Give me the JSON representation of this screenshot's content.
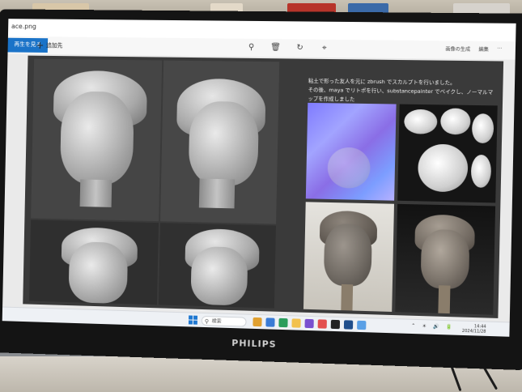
{
  "window": {
    "file_name": "ace.png"
  },
  "toolbar": {
    "slideshow_label": "再生を見る",
    "add_label": "追加先",
    "zoom_icon": "zoom-in-icon",
    "delete_icon": "trash-icon",
    "rotate_icon": "rotate-icon",
    "crop_icon": "crop-icon",
    "right_label_1": "画像の生成",
    "right_label_2": "編集"
  },
  "image": {
    "caption_line1": "粘土で形った友人を元に zbrush でスカルプトを行いました。",
    "caption_line2": "その後、maya でリトポを行い、substancepainter でベイクし、ノーマルマップを作成しました"
  },
  "taskbar": {
    "search_label": "検索",
    "tray_time": "14:44",
    "tray_date": "2024/11/28"
  },
  "monitor": {
    "brand": "PHILIPS"
  },
  "colors": {
    "accent": "#1a73c8",
    "image_background": "#3a3a3a",
    "normal_map": "#8a86ff"
  }
}
